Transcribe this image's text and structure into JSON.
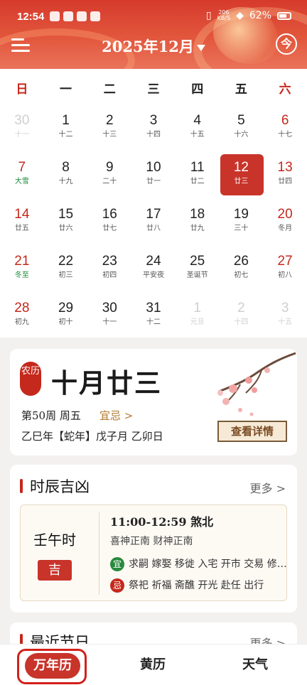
{
  "status_bar": {
    "time": "12:54",
    "network": "206\nKB/S",
    "battery": "62%"
  },
  "header": {
    "title": "2025年12月",
    "today_button": "今"
  },
  "calendar": {
    "weekdays": [
      {
        "label": "日",
        "weekend": true
      },
      {
        "label": "一",
        "weekend": false
      },
      {
        "label": "二",
        "weekend": false
      },
      {
        "label": "三",
        "weekend": false
      },
      {
        "label": "四",
        "weekend": false
      },
      {
        "label": "五",
        "weekend": false
      },
      {
        "label": "六",
        "weekend": true
      }
    ],
    "weeks": [
      [
        {
          "day": "30",
          "lunar": "十一",
          "kind": "other"
        },
        {
          "day": "1",
          "lunar": "十二",
          "kind": ""
        },
        {
          "day": "2",
          "lunar": "十三",
          "kind": ""
        },
        {
          "day": "3",
          "lunar": "十四",
          "kind": ""
        },
        {
          "day": "4",
          "lunar": "十五",
          "kind": ""
        },
        {
          "day": "5",
          "lunar": "十六",
          "kind": ""
        },
        {
          "day": "6",
          "lunar": "十七",
          "kind": "weekend"
        }
      ],
      [
        {
          "day": "7",
          "lunar": "大雪",
          "kind": "weekend term"
        },
        {
          "day": "8",
          "lunar": "十九",
          "kind": ""
        },
        {
          "day": "9",
          "lunar": "二十",
          "kind": ""
        },
        {
          "day": "10",
          "lunar": "廿一",
          "kind": ""
        },
        {
          "day": "11",
          "lunar": "廿二",
          "kind": ""
        },
        {
          "day": "12",
          "lunar": "廿三",
          "kind": "selected"
        },
        {
          "day": "13",
          "lunar": "廿四",
          "kind": "weekend"
        }
      ],
      [
        {
          "day": "14",
          "lunar": "廿五",
          "kind": "weekend"
        },
        {
          "day": "15",
          "lunar": "廿六",
          "kind": ""
        },
        {
          "day": "16",
          "lunar": "廿七",
          "kind": ""
        },
        {
          "day": "17",
          "lunar": "廿八",
          "kind": ""
        },
        {
          "day": "18",
          "lunar": "廿九",
          "kind": ""
        },
        {
          "day": "19",
          "lunar": "三十",
          "kind": ""
        },
        {
          "day": "20",
          "lunar": "冬月",
          "kind": "weekend"
        }
      ],
      [
        {
          "day": "21",
          "lunar": "冬至",
          "kind": "weekend term"
        },
        {
          "day": "22",
          "lunar": "初三",
          "kind": ""
        },
        {
          "day": "23",
          "lunar": "初四",
          "kind": ""
        },
        {
          "day": "24",
          "lunar": "平安夜",
          "kind": "fest"
        },
        {
          "day": "25",
          "lunar": "圣诞节",
          "kind": "fest"
        },
        {
          "day": "26",
          "lunar": "初七",
          "kind": ""
        },
        {
          "day": "27",
          "lunar": "初八",
          "kind": "weekend"
        }
      ],
      [
        {
          "day": "28",
          "lunar": "初九",
          "kind": "weekend"
        },
        {
          "day": "29",
          "lunar": "初十",
          "kind": ""
        },
        {
          "day": "30",
          "lunar": "十一",
          "kind": ""
        },
        {
          "day": "31",
          "lunar": "十二",
          "kind": ""
        },
        {
          "day": "1",
          "lunar": "元旦",
          "kind": "other"
        },
        {
          "day": "2",
          "lunar": "十四",
          "kind": "other"
        },
        {
          "day": "3",
          "lunar": "十五",
          "kind": "other"
        }
      ]
    ]
  },
  "lunar_card": {
    "badge": "农历",
    "date": "十月廿三",
    "week_line": "第50周 周五",
    "yiji_link": "宜忌 >",
    "ganzhi": "乙巳年【蛇年】戊子月 乙卯日",
    "detail_button": "查看详情"
  },
  "shichen": {
    "title": "时辰吉凶",
    "more": "更多 >",
    "hour": "壬午时",
    "fortune": "吉",
    "time_range": "11:00-12:59 煞北",
    "gods": "喜神正南 财神正南",
    "yi_label": "宜",
    "yi_items": "求嗣 嫁娶 移徙 入宅 开市 交易 修…",
    "ji_label": "忌",
    "ji_items": "祭祀 祈福 斋醮 开光 赴任 出行"
  },
  "festivals": {
    "title": "最近节日",
    "more": "更多 >"
  },
  "tabbar": {
    "tabs": [
      "万年历",
      "黄历",
      "天气"
    ],
    "active": 0
  },
  "colors": {
    "primary_red": "#c8342a",
    "term_green": "#1d8a3a",
    "gold": "#b0772a"
  }
}
